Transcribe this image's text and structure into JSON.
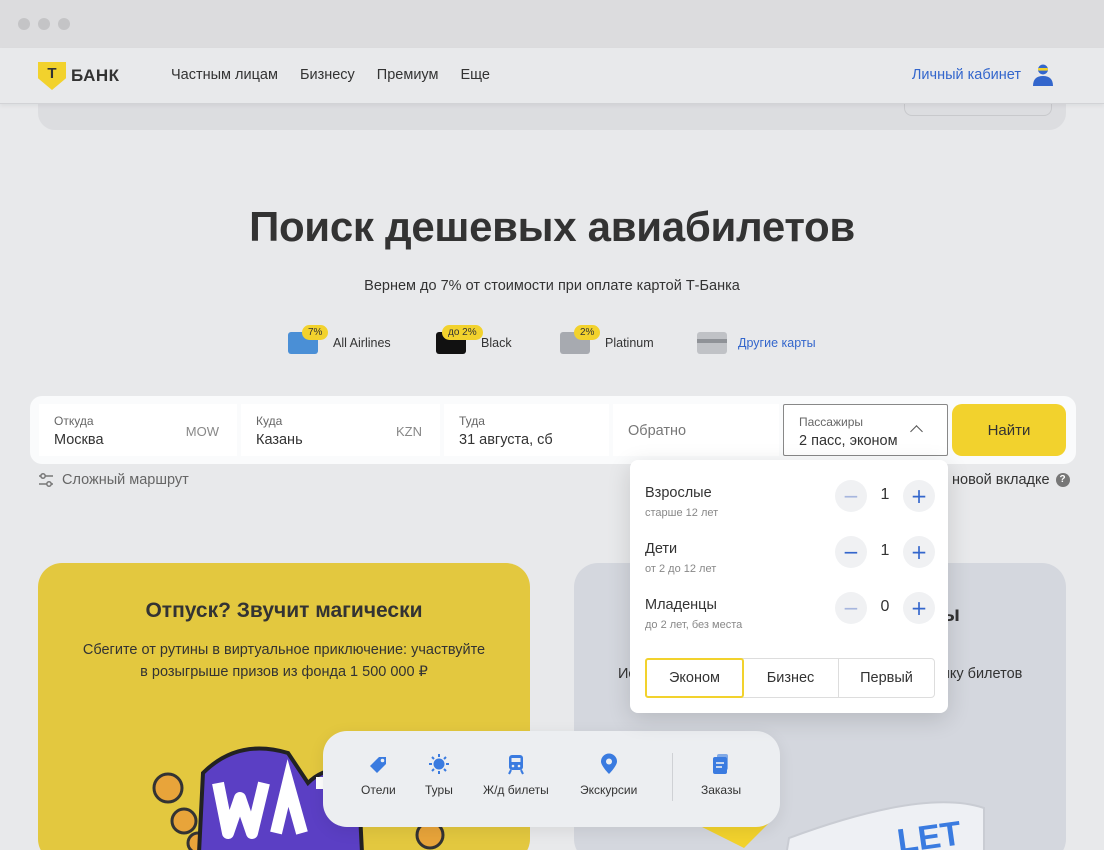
{
  "nav": {
    "logo_letter": "Т",
    "logo_text": "БАНК",
    "menu": [
      "Частным лицам",
      "Бизнесу",
      "Премиум",
      "Еще"
    ],
    "cabinet": "Личный кабинет"
  },
  "hero": {
    "title": "Поиск дешевых авиабилетов",
    "subtitle": "Вернем до 7% от стоимости при оплате картой Т-Банка"
  },
  "cards": [
    {
      "badge": "7%",
      "label": "All Airlines"
    },
    {
      "badge": "до 2%",
      "label": "Black"
    },
    {
      "badge": "2%",
      "label": "Platinum"
    },
    {
      "badge": "",
      "label": "Другие карты"
    }
  ],
  "search": {
    "from": {
      "label": "Откуда",
      "value": "Москва",
      "code": "MOW"
    },
    "to": {
      "label": "Куда",
      "value": "Казань",
      "code": "KZN"
    },
    "depart": {
      "label": "Туда",
      "value": "31 августа, сб"
    },
    "return": {
      "placeholder": "Обратно"
    },
    "passengers": {
      "label": "Пассажиры",
      "value": "2 пасс, эконом"
    },
    "find_button": "Найти",
    "complex_route": "Сложный маршрут",
    "new_tab": "новой вкладке"
  },
  "passengers_dropdown": {
    "rows": [
      {
        "title": "Взрослые",
        "subtitle": "старше 12 лет",
        "count": "1"
      },
      {
        "title": "Дети",
        "subtitle": "от 2 до 12 лет",
        "count": "1"
      },
      {
        "title": "Младенцы",
        "subtitle": "до 2 лет, без места",
        "count": "0"
      }
    ],
    "classes": [
      "Эконом",
      "Бизнес",
      "Первый"
    ],
    "selected_class": "Эконом"
  },
  "promo_left": {
    "title": "Отпуск? Звучит магически",
    "text": "Сбегите от рутины в виртуальное приключение: участвуйте в розыгрыше призов из фонда 1 500 000 ₽"
  },
  "promo_right": {
    "title_fragment": "ы",
    "text_left": "Ис",
    "text_right": "пку билетов"
  },
  "bottom_nav": [
    "Отели",
    "Туры",
    "Ж/д билеты",
    "Экскурсии",
    "Заказы"
  ],
  "colors": {
    "accent": "#f2d22d",
    "link": "#3366cc"
  }
}
